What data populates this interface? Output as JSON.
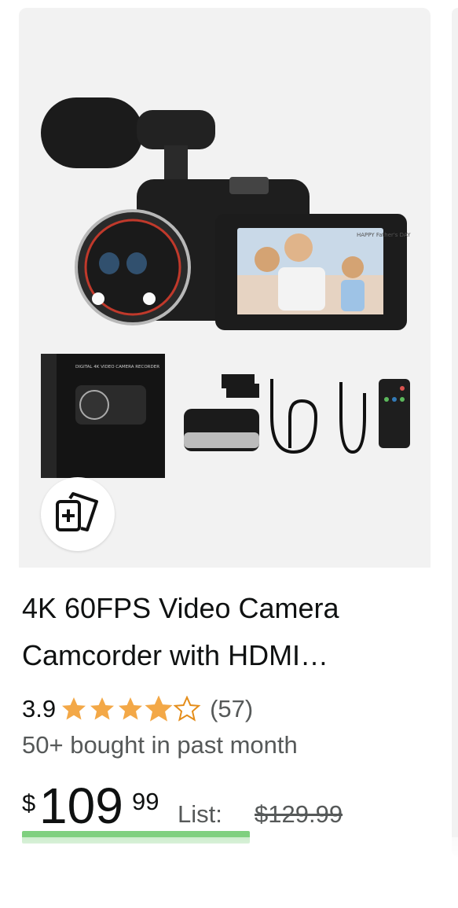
{
  "product": {
    "title": "4K 60FPS Video Camera Camcorder with HDMI…",
    "rating": "3.9",
    "rating_value": 3.9,
    "review_count": "(57)",
    "bought": "50+ bought in past month",
    "price": {
      "symbol": "$",
      "whole": "109",
      "fraction": "99"
    },
    "list_label": "List:",
    "list_price": "$129.99"
  },
  "image": {
    "box_title": "DIGITAL 4K VIDEO CAMERA RECORDER",
    "screen_banner": "HAPPY Father's DAY"
  },
  "colors": {
    "star": "#f3a847",
    "image_bg": "#f2f2f2",
    "deal_badge": "#7fd07f"
  },
  "icons": {
    "compare": "compare-icon"
  }
}
